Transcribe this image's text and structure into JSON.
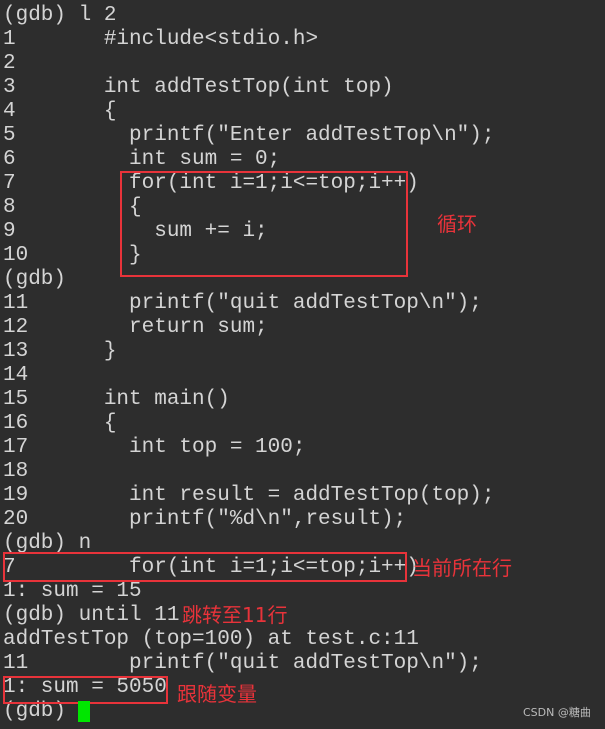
{
  "terminal": {
    "lines": [
      "(gdb) l 2",
      "1       #include<stdio.h>",
      "2",
      "3       int addTestTop(int top)",
      "4       {",
      "5         printf(\"Enter addTestTop\\n\");",
      "6         int sum = 0;",
      "7         for(int i=1;i<=top;i++)",
      "8         {",
      "9           sum += i;",
      "10        }",
      "(gdb)",
      "11        printf(\"quit addTestTop\\n\");",
      "12        return sum;",
      "13      }",
      "14",
      "15      int main()",
      "16      {",
      "17        int top = 100;",
      "18",
      "19        int result = addTestTop(top);",
      "20        printf(\"%d\\n\",result);",
      "(gdb) n",
      "7         for(int i=1;i<=top;i++)",
      "1: sum = 15",
      "(gdb) until 11",
      "addTestTop (top=100) at test.c:11",
      "11        printf(\"quit addTestTop\\n\");",
      "1: sum = 5050",
      "(gdb) "
    ],
    "cursor_color": "#00e600"
  },
  "annotations": {
    "loop": "循环",
    "current_line": "当前所在行",
    "jump_to_11": "跳转至11行",
    "follow_variable": "跟随变量",
    "color": "#e8333a"
  },
  "watermark": "CSDN @糖曲"
}
